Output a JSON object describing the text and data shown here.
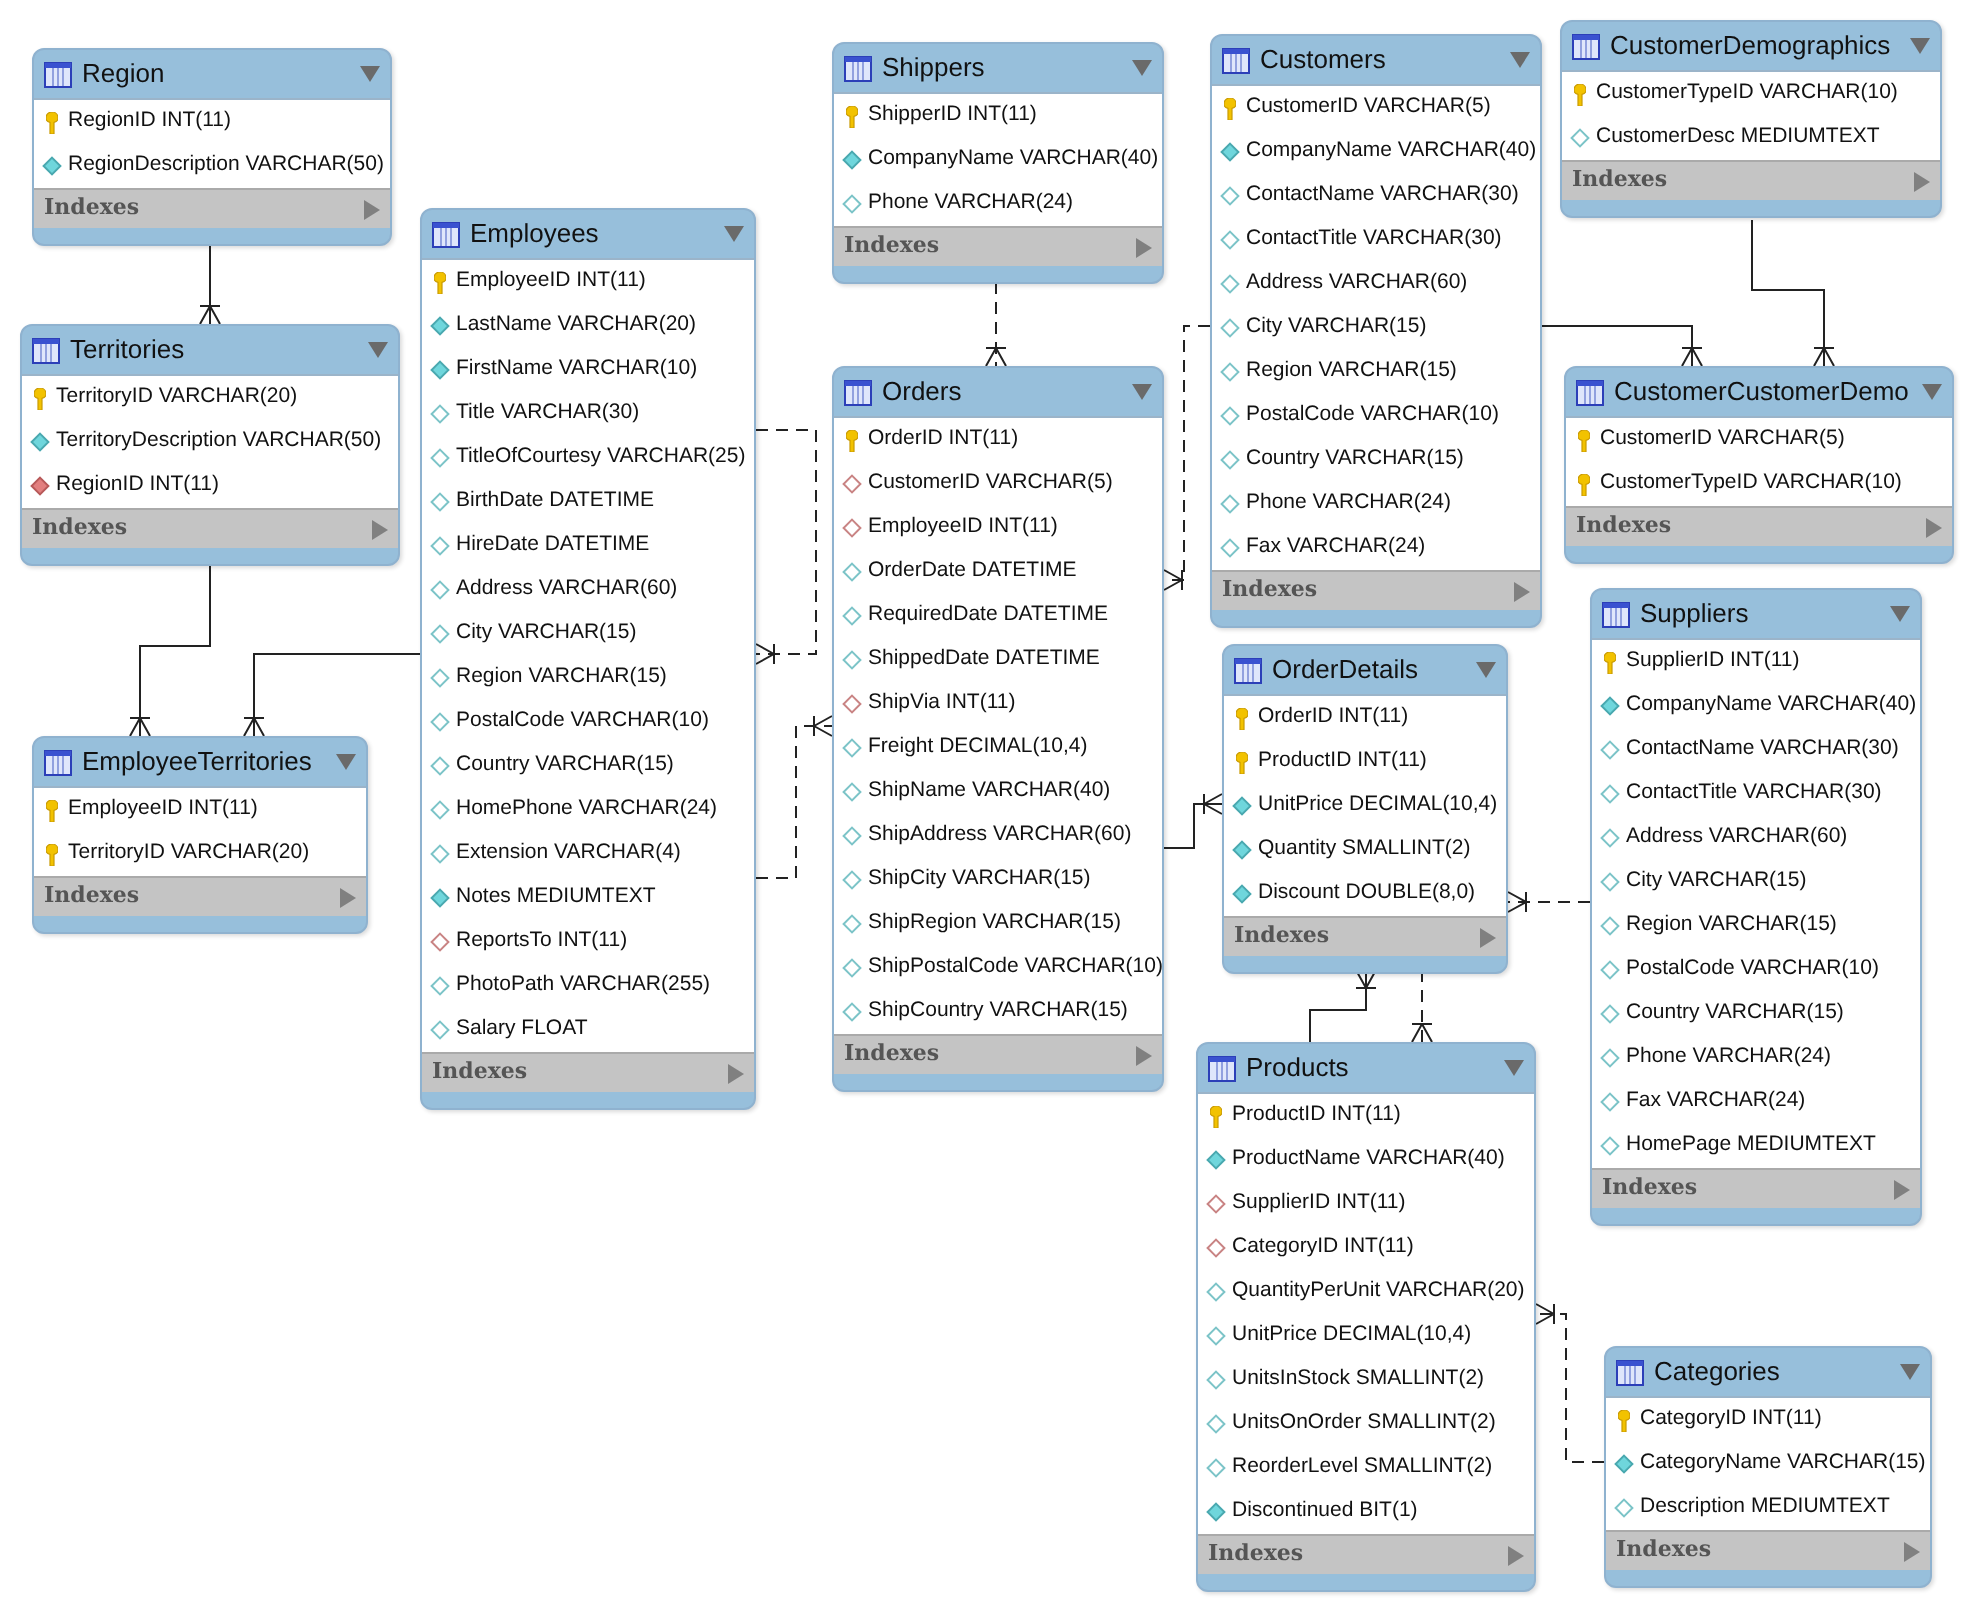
{
  "tables": [
    {
      "name": "Region",
      "indexes_label": "Indexes",
      "columns": [
        {
          "text": "RegionID INT(11)",
          "kind": "primary_key"
        },
        {
          "text": "RegionDescription VARCHAR(50)",
          "kind": "not_null"
        }
      ]
    },
    {
      "name": "Territories",
      "indexes_label": "Indexes",
      "columns": [
        {
          "text": "TerritoryID VARCHAR(20)",
          "kind": "primary_key"
        },
        {
          "text": "TerritoryDescription VARCHAR(50)",
          "kind": "not_null"
        },
        {
          "text": "RegionID INT(11)",
          "kind": "foreign_key_not_null"
        }
      ]
    },
    {
      "name": "EmployeeTerritories",
      "indexes_label": "Indexes",
      "columns": [
        {
          "text": "EmployeeID INT(11)",
          "kind": "primary_key"
        },
        {
          "text": "TerritoryID VARCHAR(20)",
          "kind": "primary_key"
        }
      ]
    },
    {
      "name": "Employees",
      "indexes_label": "Indexes",
      "columns": [
        {
          "text": "EmployeeID INT(11)",
          "kind": "primary_key"
        },
        {
          "text": "LastName VARCHAR(20)",
          "kind": "not_null"
        },
        {
          "text": "FirstName VARCHAR(10)",
          "kind": "not_null"
        },
        {
          "text": "Title VARCHAR(30)",
          "kind": "nullable"
        },
        {
          "text": "TitleOfCourtesy VARCHAR(25)",
          "kind": "nullable"
        },
        {
          "text": "BirthDate DATETIME",
          "kind": "nullable"
        },
        {
          "text": "HireDate DATETIME",
          "kind": "nullable"
        },
        {
          "text": "Address VARCHAR(60)",
          "kind": "nullable"
        },
        {
          "text": "City VARCHAR(15)",
          "kind": "nullable"
        },
        {
          "text": "Region VARCHAR(15)",
          "kind": "nullable"
        },
        {
          "text": "PostalCode VARCHAR(10)",
          "kind": "nullable"
        },
        {
          "text": "Country VARCHAR(15)",
          "kind": "nullable"
        },
        {
          "text": "HomePhone VARCHAR(24)",
          "kind": "nullable"
        },
        {
          "text": "Extension VARCHAR(4)",
          "kind": "nullable"
        },
        {
          "text": "Notes MEDIUMTEXT",
          "kind": "not_null"
        },
        {
          "text": "ReportsTo INT(11)",
          "kind": "foreign_key"
        },
        {
          "text": "PhotoPath VARCHAR(255)",
          "kind": "nullable"
        },
        {
          "text": "Salary FLOAT",
          "kind": "nullable"
        }
      ]
    },
    {
      "name": "Shippers",
      "indexes_label": "Indexes",
      "columns": [
        {
          "text": "ShipperID INT(11)",
          "kind": "primary_key"
        },
        {
          "text": "CompanyName VARCHAR(40)",
          "kind": "not_null"
        },
        {
          "text": "Phone VARCHAR(24)",
          "kind": "nullable"
        }
      ]
    },
    {
      "name": "Orders",
      "indexes_label": "Indexes",
      "columns": [
        {
          "text": "OrderID INT(11)",
          "kind": "primary_key"
        },
        {
          "text": "CustomerID VARCHAR(5)",
          "kind": "foreign_key"
        },
        {
          "text": "EmployeeID INT(11)",
          "kind": "foreign_key"
        },
        {
          "text": "OrderDate DATETIME",
          "kind": "nullable"
        },
        {
          "text": "RequiredDate DATETIME",
          "kind": "nullable"
        },
        {
          "text": "ShippedDate DATETIME",
          "kind": "nullable"
        },
        {
          "text": "ShipVia INT(11)",
          "kind": "foreign_key"
        },
        {
          "text": "Freight DECIMAL(10,4)",
          "kind": "nullable"
        },
        {
          "text": "ShipName VARCHAR(40)",
          "kind": "nullable"
        },
        {
          "text": "ShipAddress VARCHAR(60)",
          "kind": "nullable"
        },
        {
          "text": "ShipCity VARCHAR(15)",
          "kind": "nullable"
        },
        {
          "text": "ShipRegion VARCHAR(15)",
          "kind": "nullable"
        },
        {
          "text": "ShipPostalCode VARCHAR(10)",
          "kind": "nullable"
        },
        {
          "text": "ShipCountry VARCHAR(15)",
          "kind": "nullable"
        }
      ]
    },
    {
      "name": "Customers",
      "indexes_label": "Indexes",
      "columns": [
        {
          "text": "CustomerID VARCHAR(5)",
          "kind": "primary_key"
        },
        {
          "text": "CompanyName VARCHAR(40)",
          "kind": "not_null"
        },
        {
          "text": "ContactName VARCHAR(30)",
          "kind": "nullable"
        },
        {
          "text": "ContactTitle VARCHAR(30)",
          "kind": "nullable"
        },
        {
          "text": "Address VARCHAR(60)",
          "kind": "nullable"
        },
        {
          "text": "City VARCHAR(15)",
          "kind": "nullable"
        },
        {
          "text": "Region VARCHAR(15)",
          "kind": "nullable"
        },
        {
          "text": "PostalCode VARCHAR(10)",
          "kind": "nullable"
        },
        {
          "text": "Country VARCHAR(15)",
          "kind": "nullable"
        },
        {
          "text": "Phone VARCHAR(24)",
          "kind": "nullable"
        },
        {
          "text": "Fax VARCHAR(24)",
          "kind": "nullable"
        }
      ]
    },
    {
      "name": "CustomerDemographics",
      "indexes_label": "Indexes",
      "columns": [
        {
          "text": "CustomerTypeID VARCHAR(10)",
          "kind": "primary_key"
        },
        {
          "text": "CustomerDesc MEDIUMTEXT",
          "kind": "nullable"
        }
      ]
    },
    {
      "name": "CustomerCustomerDemo",
      "indexes_label": "Indexes",
      "columns": [
        {
          "text": "CustomerID VARCHAR(5)",
          "kind": "primary_key"
        },
        {
          "text": "CustomerTypeID VARCHAR(10)",
          "kind": "primary_key"
        }
      ]
    },
    {
      "name": "Suppliers",
      "indexes_label": "Indexes",
      "columns": [
        {
          "text": "SupplierID INT(11)",
          "kind": "primary_key"
        },
        {
          "text": "CompanyName VARCHAR(40)",
          "kind": "not_null"
        },
        {
          "text": "ContactName VARCHAR(30)",
          "kind": "nullable"
        },
        {
          "text": "ContactTitle VARCHAR(30)",
          "kind": "nullable"
        },
        {
          "text": "Address VARCHAR(60)",
          "kind": "nullable"
        },
        {
          "text": "City VARCHAR(15)",
          "kind": "nullable"
        },
        {
          "text": "Region VARCHAR(15)",
          "kind": "nullable"
        },
        {
          "text": "PostalCode VARCHAR(10)",
          "kind": "nullable"
        },
        {
          "text": "Country VARCHAR(15)",
          "kind": "nullable"
        },
        {
          "text": "Phone VARCHAR(24)",
          "kind": "nullable"
        },
        {
          "text": "Fax VARCHAR(24)",
          "kind": "nullable"
        },
        {
          "text": "HomePage MEDIUMTEXT",
          "kind": "nullable"
        }
      ]
    },
    {
      "name": "OrderDetails",
      "indexes_label": "Indexes",
      "columns": [
        {
          "text": "OrderID INT(11)",
          "kind": "primary_key"
        },
        {
          "text": "ProductID INT(11)",
          "kind": "primary_key"
        },
        {
          "text": "UnitPrice DECIMAL(10,4)",
          "kind": "not_null"
        },
        {
          "text": "Quantity SMALLINT(2)",
          "kind": "not_null"
        },
        {
          "text": "Discount DOUBLE(8,0)",
          "kind": "not_null"
        }
      ]
    },
    {
      "name": "Products",
      "indexes_label": "Indexes",
      "columns": [
        {
          "text": "ProductID INT(11)",
          "kind": "primary_key"
        },
        {
          "text": "ProductName VARCHAR(40)",
          "kind": "not_null"
        },
        {
          "text": "SupplierID INT(11)",
          "kind": "foreign_key"
        },
        {
          "text": "CategoryID INT(11)",
          "kind": "foreign_key"
        },
        {
          "text": "QuantityPerUnit VARCHAR(20)",
          "kind": "nullable"
        },
        {
          "text": "UnitPrice DECIMAL(10,4)",
          "kind": "nullable"
        },
        {
          "text": "UnitsInStock SMALLINT(2)",
          "kind": "nullable"
        },
        {
          "text": "UnitsOnOrder SMALLINT(2)",
          "kind": "nullable"
        },
        {
          "text": "ReorderLevel SMALLINT(2)",
          "kind": "nullable"
        },
        {
          "text": "Discontinued BIT(1)",
          "kind": "not_null"
        }
      ]
    },
    {
      "name": "Categories",
      "indexes_label": "Indexes",
      "columns": [
        {
          "text": "CategoryID INT(11)",
          "kind": "primary_key"
        },
        {
          "text": "CategoryName VARCHAR(15)",
          "kind": "not_null"
        },
        {
          "text": "Description MEDIUMTEXT",
          "kind": "nullable"
        }
      ]
    }
  ]
}
